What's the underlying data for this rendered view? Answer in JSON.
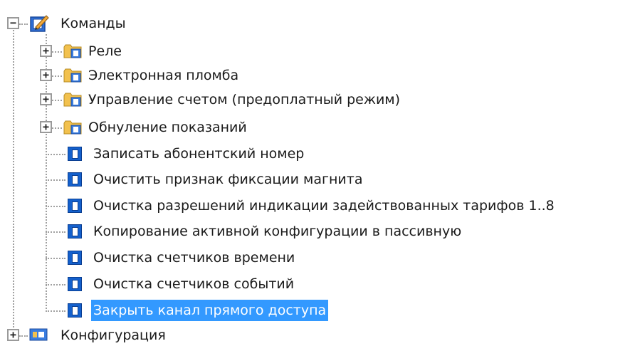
{
  "tree": {
    "root": {
      "label": "Команды",
      "expander": "−",
      "icon": "commands-folder-icon"
    },
    "folders": [
      {
        "label": "Реле",
        "expander": "+",
        "icon": "folder-icon"
      },
      {
        "label": "Электронная пломба",
        "expander": "+",
        "icon": "folder-icon"
      },
      {
        "label": "Управление счетом (предоплатный режим)",
        "expander": "+",
        "icon": "folder-icon"
      },
      {
        "label": "Обнуление показаний",
        "expander": "+",
        "icon": "folder-icon"
      }
    ],
    "commands": [
      {
        "label": "Записать абонентский номер",
        "icon": "command-icon"
      },
      {
        "label": "Очистить признак фиксации магнита",
        "icon": "command-icon"
      },
      {
        "label": "Очистка разрешений индикации задействованных тарифов 1..8",
        "icon": "command-icon"
      },
      {
        "label": "Копирование активной конфигурации в пассивную",
        "icon": "command-icon"
      },
      {
        "label": "Очистка счетчиков времени",
        "icon": "command-icon"
      },
      {
        "label": "Очистка счетчиков событий",
        "icon": "command-icon"
      },
      {
        "label": "Закрыть канал прямого доступа",
        "icon": "command-icon",
        "selected": true
      }
    ],
    "next_root": {
      "label": "Конфигурация",
      "expander": "+",
      "icon": "configuration-icon"
    }
  },
  "colors": {
    "selection": "#3399ff",
    "command_icon": "#1460cc",
    "folder": "#f2c14e"
  }
}
